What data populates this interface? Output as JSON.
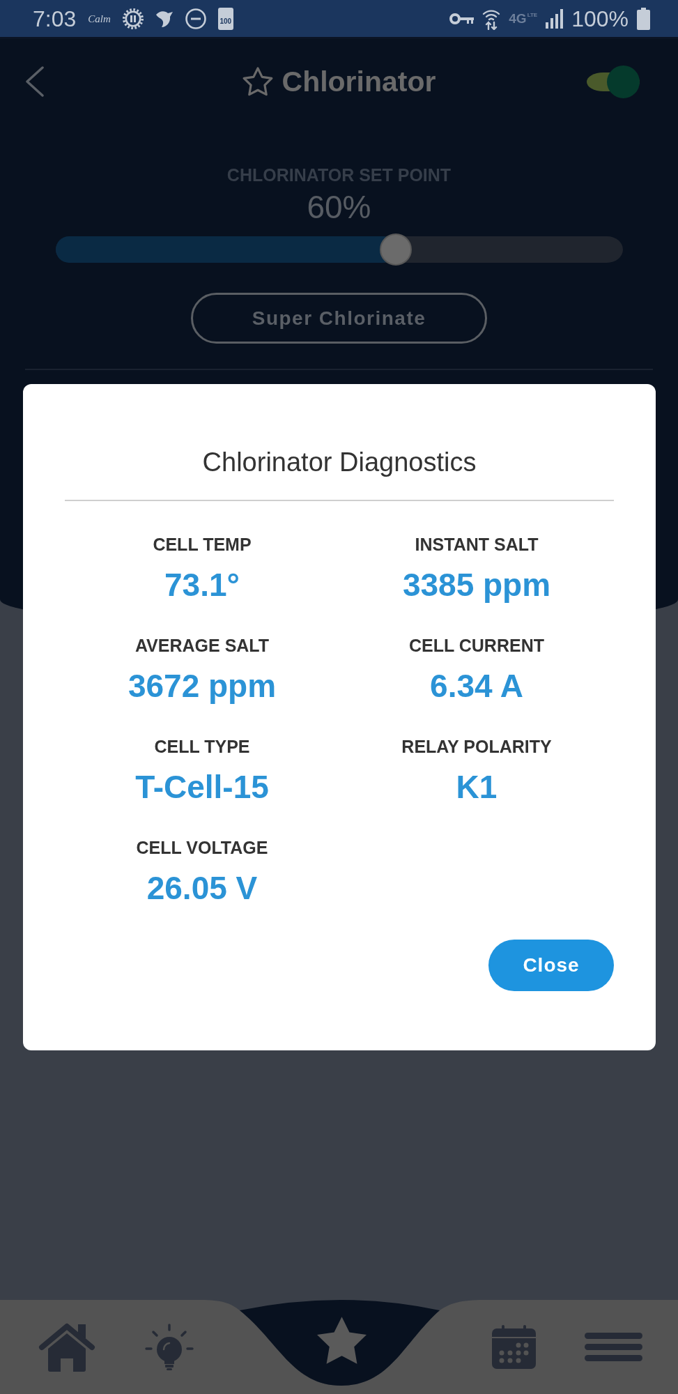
{
  "status_bar": {
    "time": "7:03",
    "calm_logo": "Calm",
    "battery_notification": "100",
    "network_type": "4G",
    "network_subtype": "LTE",
    "battery_percent": "100%"
  },
  "header": {
    "title": "Chlorinator",
    "favorite": false,
    "toggle": {
      "on": true
    }
  },
  "setpoint": {
    "label": "CHLORINATOR SET POINT",
    "reading": "60%",
    "level": 0.6
  },
  "super_chlorinate_button": "Super Chlorinate",
  "dialog": {
    "title": "Chlorinator Diagnostics",
    "readings": [
      {
        "label": "CELL TEMP",
        "value": "73.1°"
      },
      {
        "label": "INSTANT SALT",
        "value": "3385 ppm"
      },
      {
        "label": "AVERAGE SALT",
        "value": "3672 ppm"
      },
      {
        "label": "CELL CURRENT",
        "value": "6.34 A"
      },
      {
        "label": "CELL TYPE",
        "value": "T-Cell-15"
      },
      {
        "label": "RELAY POLARITY",
        "value": "K1"
      },
      {
        "label": "CELL VOLTAGE",
        "value": "26.05 V"
      }
    ],
    "close_button": "Close"
  },
  "bottom_nav": {
    "items": [
      {
        "kind": "home",
        "selected": false
      },
      {
        "kind": "lightbulb",
        "selected": false
      },
      {
        "kind": "star",
        "selected": true
      },
      {
        "kind": "calendar",
        "selected": false
      },
      {
        "kind": "menu",
        "selected": false
      }
    ]
  }
}
